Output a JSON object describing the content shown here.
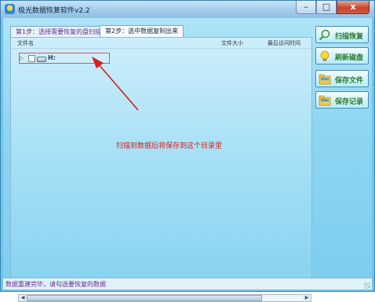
{
  "window": {
    "title": "极光数据恢复软件v2.2"
  },
  "window_controls": {
    "minimize": "–",
    "maximize": "□",
    "close": "x"
  },
  "tabs": [
    {
      "label": "第1步：选择需要恢复的盘扫描"
    },
    {
      "label": "第2步：选中数据复制出来",
      "active": true
    }
  ],
  "table": {
    "columns": {
      "name": "文件名",
      "size": "文件大小",
      "last_access": "最后访问时间"
    },
    "rows": [
      {
        "expander": "▷",
        "checked": false,
        "icon": "drive-icon",
        "label": "H:"
      }
    ]
  },
  "annotation": {
    "text": "扫描到数据后将保存到这个目录里",
    "color": "#d61e1e"
  },
  "side_buttons": [
    {
      "label": "扫描恢复",
      "icon": "magnifier-icon"
    },
    {
      "label": "刷新磁盘",
      "icon": "lightbulb-icon"
    },
    {
      "label": "保存文件",
      "icon": "folder-icon"
    },
    {
      "label": "保存记录",
      "icon": "folder-icon"
    }
  ],
  "status": {
    "text": "数据重建完毕，请勾选要恢复的数据"
  },
  "colors": {
    "accent": "#2c7a28",
    "tab_text": "#6b2d8f",
    "highlight": "#e05454"
  }
}
